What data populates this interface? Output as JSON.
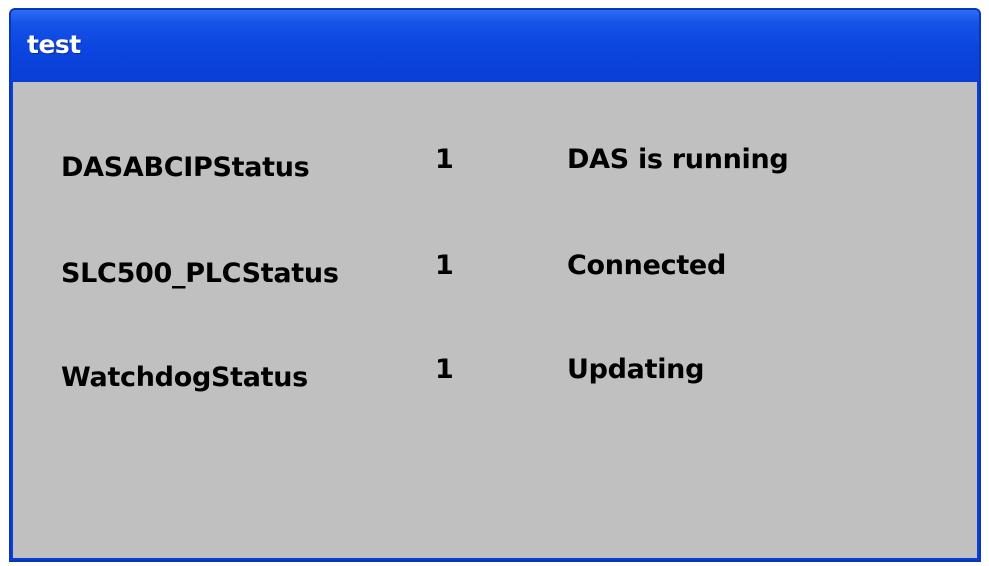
{
  "window": {
    "title": "test"
  },
  "status_rows": [
    {
      "name": "DASABCIPStatus",
      "value": "1",
      "status": "DAS is running"
    },
    {
      "name": "SLC500_PLCStatus",
      "value": "1",
      "status": "Connected"
    },
    {
      "name": "WatchdogStatus",
      "value": "1",
      "status": "Updating"
    }
  ],
  "colors": {
    "titlebar": "#0a3fd6",
    "client_background": "#c0c0c0",
    "title_text": "#ffffff",
    "body_text": "#000000"
  }
}
